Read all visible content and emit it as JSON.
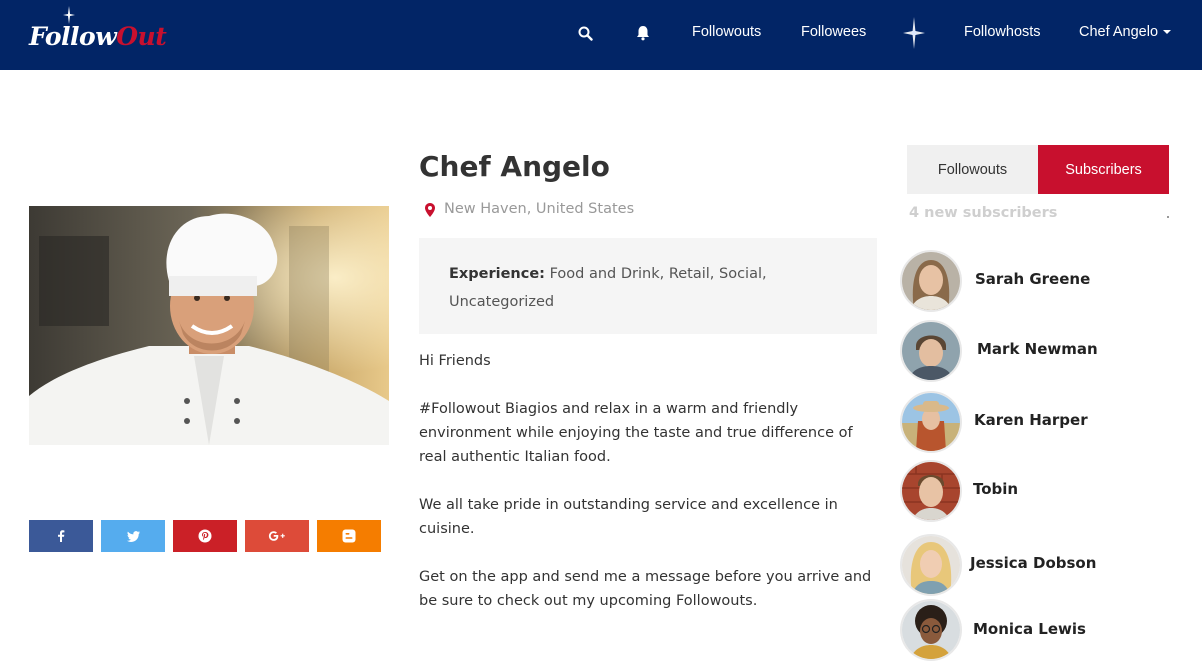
{
  "brand": {
    "part1": "Follow",
    "part2": "Out",
    "colors": {
      "nav_bg": "#022566",
      "accent": "#c8102e"
    }
  },
  "nav": {
    "icons": [
      "search-icon",
      "bell-icon",
      "star-icon"
    ],
    "items": {
      "followouts": "Followouts",
      "followees": "Followees",
      "followhosts": "Followhosts",
      "user": "Chef Angelo"
    }
  },
  "profile": {
    "name": "Chef Angelo",
    "location": "New Haven, United States",
    "experience_label": "Experience:",
    "experience_value": "Food and Drink, Retail, Social, Uncategorized",
    "bio": [
      "Hi Friends",
      "#Followout Biagios and relax in a warm and friendly environment while enjoying the taste and true difference of real authentic Italian food.",
      "We all take pride in outstanding service and excellence in cuisine.",
      "Get on the app and send me a message before you arrive and be sure to check out my upcoming Followouts."
    ]
  },
  "share": [
    {
      "icon": "facebook-icon",
      "color": "#3b5998"
    },
    {
      "icon": "twitter-icon",
      "color": "#55acee"
    },
    {
      "icon": "pinterest-icon",
      "color": "#cb2027"
    },
    {
      "icon": "google-plus-icon",
      "color": "#dd4b39"
    },
    {
      "icon": "blogger-icon",
      "color": "#f57d00"
    }
  ],
  "sidebar": {
    "tabs": {
      "followouts": "Followouts",
      "subscribers": "Subscribers"
    },
    "new_subscribers": "4 new subscribers",
    "subscribers": [
      {
        "name": "Sarah Greene"
      },
      {
        "name": "Mark Newman"
      },
      {
        "name": "Karen Harper"
      },
      {
        "name": "Tobin"
      },
      {
        "name": "Jessica Dobson"
      },
      {
        "name": "Monica Lewis"
      }
    ]
  }
}
